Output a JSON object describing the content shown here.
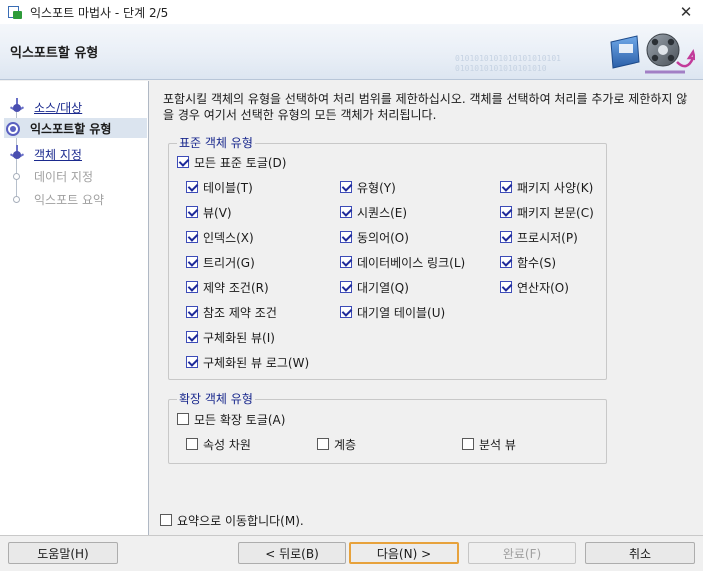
{
  "window": {
    "title": "익스포트 마법사 - 단계 2/5",
    "close_glyph": "✕"
  },
  "header": {
    "heading": "익스포트할 유형",
    "watermark_lines": [
      "0101010101010101010101",
      "0101010101010101010"
    ]
  },
  "nav": {
    "steps": [
      {
        "label": "소스/대상",
        "state": "done"
      },
      {
        "label": "익스포트할 유형",
        "state": "current"
      },
      {
        "label": "객체 지정",
        "state": "done"
      },
      {
        "label": "데이터 지정",
        "state": "pending"
      },
      {
        "label": "익스포트 요약",
        "state": "pending"
      }
    ]
  },
  "main": {
    "description": "포함시킬 객체의 유형을 선택하여 처리 범위를 제한하십시오. 객체를 선택하여 처리를 추가로 제한하지 않을 경우 여기서 선택한 유형의 모든 객체가 처리됩니다.",
    "standard": {
      "legend": "표준 객체 유형",
      "toggle_all": {
        "label": "모든 표준 토글(D)",
        "checked": true
      },
      "col1": [
        {
          "label": "테이블(T)",
          "checked": true
        },
        {
          "label": "뷰(V)",
          "checked": true
        },
        {
          "label": "인덱스(X)",
          "checked": true
        },
        {
          "label": "트리거(G)",
          "checked": true
        },
        {
          "label": "제약 조건(R)",
          "checked": true
        },
        {
          "label": "참조 제약 조건",
          "checked": true
        },
        {
          "label": "구체화된 뷰(I)",
          "checked": true
        },
        {
          "label": "구체화된 뷰 로그(W)",
          "checked": true
        }
      ],
      "col2": [
        {
          "label": "유형(Y)",
          "checked": true
        },
        {
          "label": "시퀀스(E)",
          "checked": true
        },
        {
          "label": "동의어(O)",
          "checked": true
        },
        {
          "label": "데이터베이스 링크(L)",
          "checked": true
        },
        {
          "label": "대기열(Q)",
          "checked": true
        },
        {
          "label": "대기열 테이블(U)",
          "checked": true
        }
      ],
      "col3": [
        {
          "label": "패키지 사양(K)",
          "checked": true
        },
        {
          "label": "패키지 본문(C)",
          "checked": true
        },
        {
          "label": "프로시저(P)",
          "checked": true
        },
        {
          "label": "함수(S)",
          "checked": true
        },
        {
          "label": "연산자(O)",
          "checked": true
        }
      ]
    },
    "extended": {
      "legend": "확장 객체 유형",
      "toggle_all": {
        "label": "모든 확장 토글(A)",
        "checked": false
      },
      "items": [
        {
          "label": "속성 차원",
          "checked": false
        },
        {
          "label": "계층",
          "checked": false
        },
        {
          "label": "분석 뷰",
          "checked": false
        }
      ]
    },
    "skip_to_summary": {
      "label": "요약으로 이동합니다(M).",
      "checked": false
    }
  },
  "footer": {
    "help": "도움말(H)",
    "back": "< 뒤로(B)",
    "next": "다음(N) >",
    "finish": "완료(F)",
    "cancel": "취소"
  }
}
